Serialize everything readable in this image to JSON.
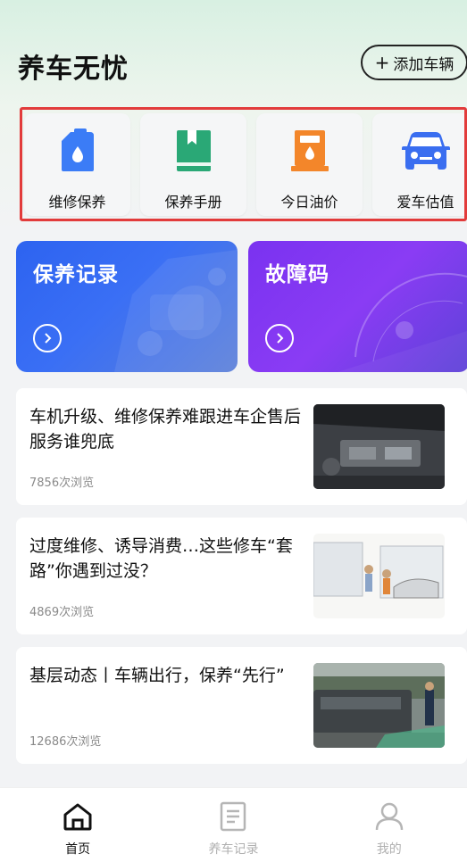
{
  "header": {
    "title": "养车无忧",
    "add_car_label": "添加车辆"
  },
  "quick_actions": [
    {
      "label": "维修保养",
      "icon": "oil-can-icon",
      "color": "#3b7cf6"
    },
    {
      "label": "保养手册",
      "icon": "manual-book-icon",
      "color": "#2aa876"
    },
    {
      "label": "今日油价",
      "icon": "fuel-pump-icon",
      "color": "#f3862a"
    },
    {
      "label": "爱车估值",
      "icon": "car-front-icon",
      "color": "#3a6ef0"
    }
  ],
  "feature_cards": [
    {
      "title": "保养记录",
      "color": "#2d63f0"
    },
    {
      "title": "故障码",
      "color": "#7a32f0"
    }
  ],
  "news": [
    {
      "title": "车机升级、维修保养难跟进车企售后服务谁兜底",
      "views": "7856次浏览"
    },
    {
      "title": "过度维修、诱导消费…这些修车“套路”你遇到过没？",
      "views": "4869次浏览"
    },
    {
      "title": "基层动态丨车辆出行，保养“先行”",
      "views": "12686次浏览"
    }
  ],
  "tabbar": [
    {
      "label": "首页",
      "icon": "home-icon",
      "active": true
    },
    {
      "label": "养车记录",
      "icon": "document-icon",
      "active": false
    },
    {
      "label": "我的",
      "icon": "user-icon",
      "active": false
    }
  ]
}
